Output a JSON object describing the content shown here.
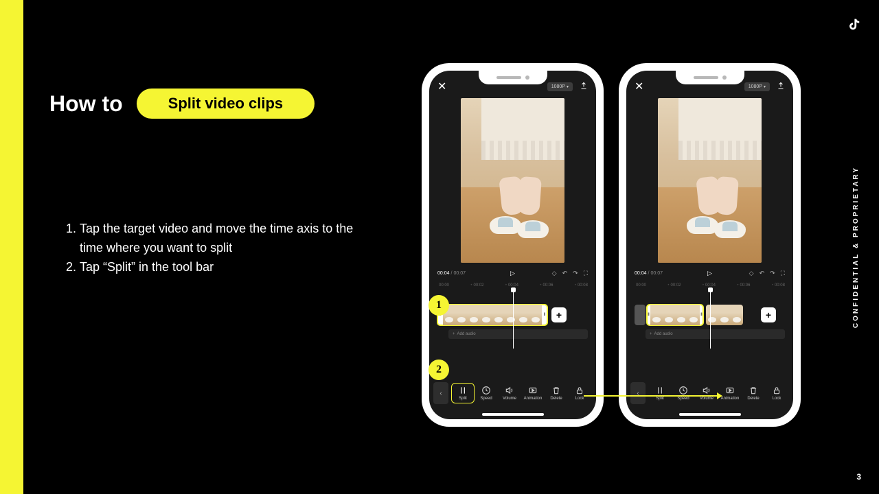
{
  "title": {
    "prefix": "How to",
    "pill": "Split video clips"
  },
  "instructions": [
    "Tap the target video and move the time axis to the time where you want to split",
    "Tap “Split” in the tool bar"
  ],
  "phone": {
    "resolution": "1080P",
    "time_current": "00:04",
    "time_total": "00:07",
    "ruler": [
      "00:00",
      "00:02",
      "00:04",
      "00:06",
      "00:08"
    ],
    "add_audio": "Add audio",
    "tools": [
      "Split",
      "Speed",
      "Volume",
      "Animation",
      "Delete",
      "Lock"
    ]
  },
  "callouts": [
    "1",
    "2"
  ],
  "confidential": "CONFIDENTIAL & PROPRIETARY",
  "page_number": "3",
  "colors": {
    "accent": "#f5f533",
    "bg": "#000000"
  }
}
